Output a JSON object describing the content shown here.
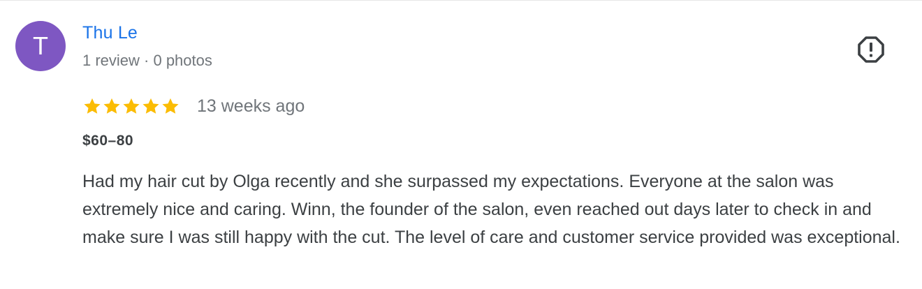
{
  "review": {
    "avatar_initial": "T",
    "reviewer_name": "Thu Le",
    "reviewer_meta": "1 review · 0 photos",
    "rating": 5,
    "rating_max": 5,
    "date": "13 weeks ago",
    "price": "$60–80",
    "text": "Had my hair cut by Olga recently and she surpassed my expectations. Everyone at the salon was extremely nice and caring. Winn, the founder of the salon, even reached out days later to check in and make sure I was still happy with the cut. The level of care and customer service provided was exceptional."
  },
  "icons": {
    "report": "report-flag-icon",
    "star": "star-icon"
  },
  "colors": {
    "avatar_bg": "#7e57c2",
    "name_link": "#1a73e8",
    "star": "#fbbc04",
    "meta": "#70757a",
    "text": "#3c4043"
  }
}
